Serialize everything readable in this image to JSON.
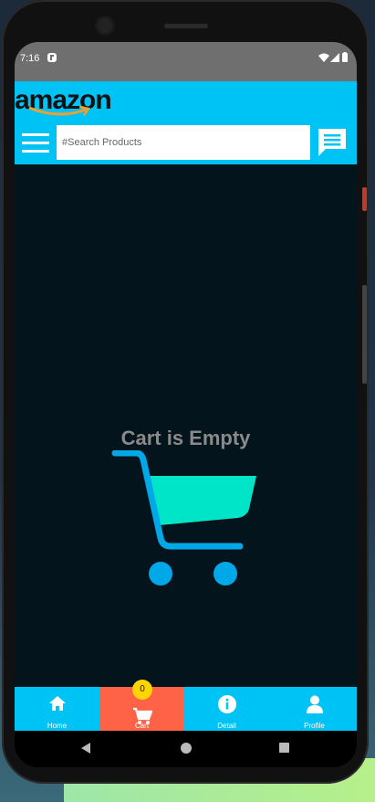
{
  "status_bar": {
    "time": "7:16"
  },
  "app_bar": {
    "logo_text": "amazon",
    "search_placeholder": "#Search Products",
    "menu_icon": "hamburger-menu-icon",
    "chat_icon": "chat-bubble-icon"
  },
  "cart": {
    "empty_message": "Cart is Empty",
    "cart_icon_colors": {
      "basket": "#00e5c8",
      "frame": "#00a8e8"
    }
  },
  "bottom_nav": {
    "items": [
      {
        "label": "Home",
        "icon": "home-icon",
        "active": false
      },
      {
        "label": "Cart",
        "icon": "cart-icon",
        "active": true,
        "badge": "0"
      },
      {
        "label": "Detail",
        "icon": "info-icon",
        "active": false
      },
      {
        "label": "Profile",
        "icon": "person-icon",
        "active": false
      }
    ]
  },
  "colors": {
    "accent": "#00c3f5",
    "active_tab": "#ff6347",
    "badge": "#ffd400",
    "content_bg": "#04141c"
  }
}
